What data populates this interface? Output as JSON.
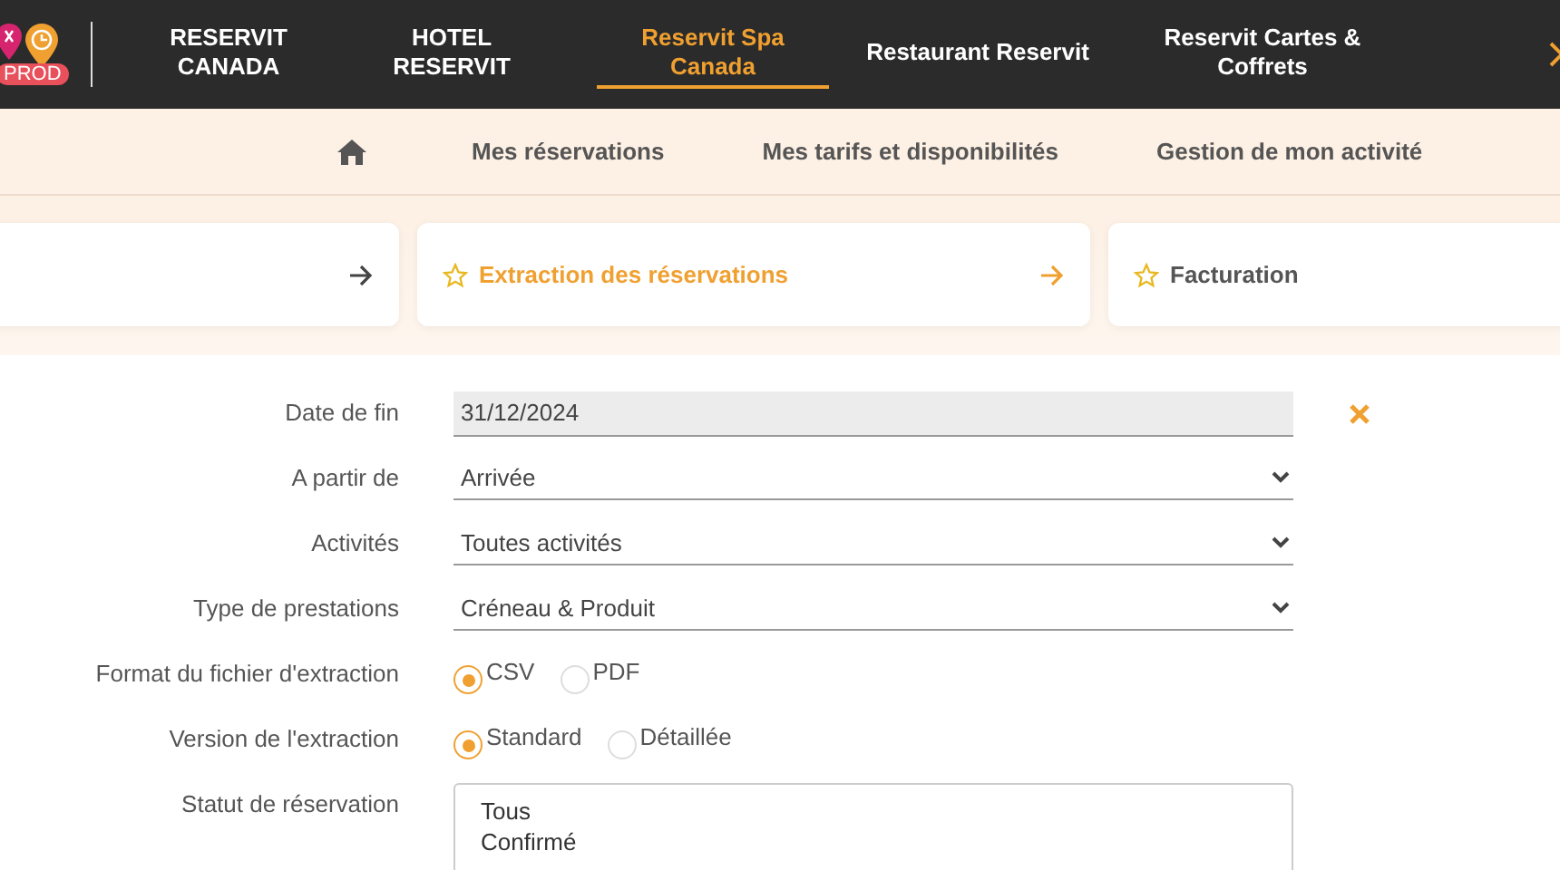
{
  "top_nav": {
    "badge": "PROD",
    "items": [
      {
        "label": "RESERVIT CANADA",
        "selected": false
      },
      {
        "label": "HOTEL RESERVIT",
        "selected": false
      },
      {
        "label": "Reservit Spa Canada",
        "selected": true
      },
      {
        "label": "Restaurant Reservit",
        "selected": false
      },
      {
        "label": "Reservit Cartes & Coffrets",
        "selected": false
      }
    ]
  },
  "sub_nav": {
    "items": [
      "Mes réservations",
      "Mes tarifs et disponibilités",
      "Gestion de mon activité"
    ]
  },
  "cards": [
    {
      "starred": false,
      "arrow": true,
      "selected": false
    },
    {
      "label": "Extraction des réservations",
      "starred": true,
      "arrow": true,
      "selected": true
    },
    {
      "label": "Facturation",
      "starred": true,
      "arrow": false,
      "selected": false
    }
  ],
  "form": {
    "fields": [
      {
        "kind": "text",
        "label": "Date de fin",
        "value": "31/12/2024",
        "clearable": true
      },
      {
        "kind": "select",
        "label": "A partir de",
        "value": "Arrivée"
      },
      {
        "kind": "select",
        "label": "Activités",
        "value": "Toutes activités"
      },
      {
        "kind": "select",
        "label": "Type de prestations",
        "value": "Créneau & Produit"
      },
      {
        "kind": "radio",
        "label": "Format du fichier d'extraction",
        "options": [
          {
            "label": "CSV",
            "selected": true
          },
          {
            "label": "PDF",
            "selected": false
          }
        ]
      },
      {
        "kind": "radio",
        "label": "Version de l'extraction",
        "options": [
          {
            "label": "Standard",
            "selected": true
          },
          {
            "label": "Détaillée",
            "selected": false
          }
        ]
      },
      {
        "kind": "list",
        "label": "Statut de réservation",
        "options": [
          "Tous",
          "Confirmé"
        ]
      }
    ]
  }
}
